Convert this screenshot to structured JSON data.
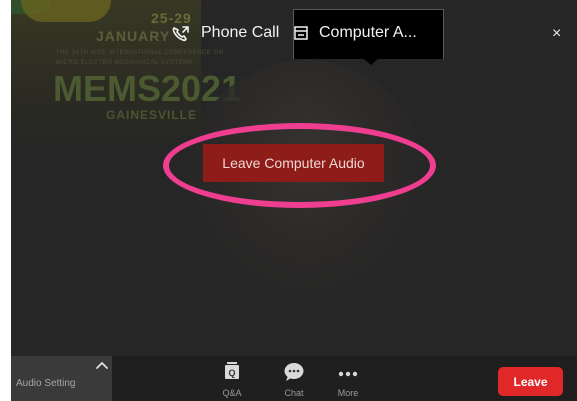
{
  "background": {
    "date_text": "25-29",
    "month_text": "JANUARY",
    "small_line_1": "THE 34TH IEEE INTERNATIONAL CONFERENCE ON",
    "small_line_2": "MICRO ELECTRO MECHANICAL SYSTEMS",
    "event_title": "MEMS2021",
    "event_subtitle": "GAINESVILLE"
  },
  "topbar": {
    "phone_tab": {
      "label": "Phone Call",
      "icon": "phone-icon"
    },
    "computer_tab": {
      "label": "Computer A...",
      "icon": "computer-icon",
      "selected": true
    },
    "close": {
      "label": "×",
      "icon": "close-icon"
    }
  },
  "main": {
    "leave_audio_button": "Leave Computer Audio",
    "highlight_color": "#ef3e8f"
  },
  "toolbar": {
    "audio_setting_label": "Audio Setting",
    "audio_chevron_icon": "chevron-up-icon",
    "tools": [
      {
        "label": "Q&A",
        "icon": "qa-icon"
      },
      {
        "label": "Chat",
        "icon": "chat-icon"
      },
      {
        "label": "More",
        "icon": "more-icon"
      }
    ],
    "leave_label": "Leave",
    "leave_color": "#e02828"
  }
}
